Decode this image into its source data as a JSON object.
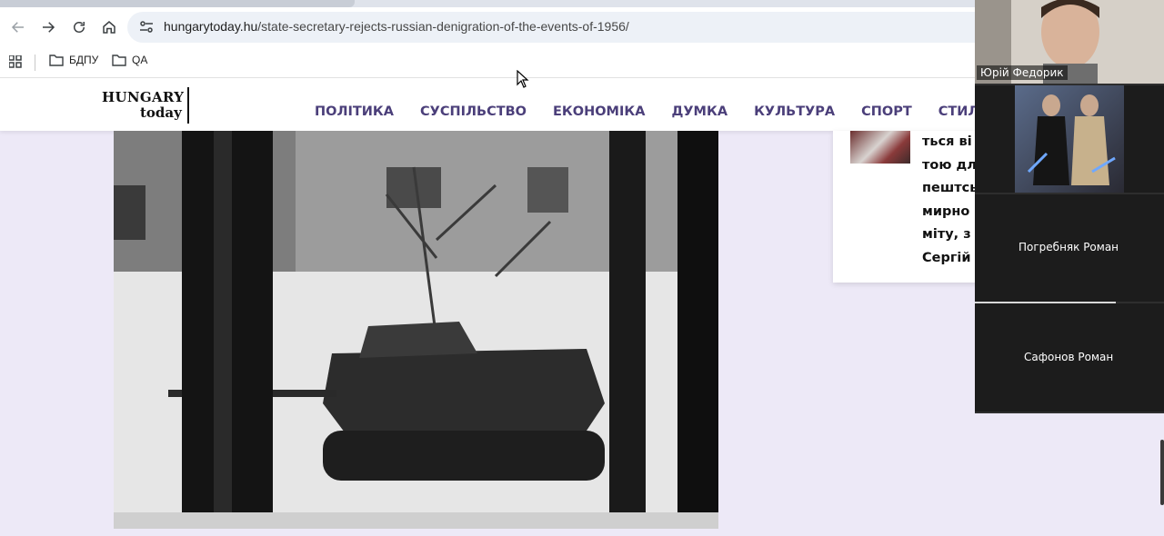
{
  "browser": {
    "url_host": "hungarytoday.hu",
    "url_path": "/state-secretary-rejects-russian-denigration-of-the-events-of-1956/",
    "icons": [
      "back-arrow-icon",
      "forward-arrow-icon",
      "reload-icon",
      "home-icon",
      "site-info-icon"
    ],
    "bookmarks": [
      {
        "label": "БДПУ",
        "icon": "folder-icon"
      },
      {
        "label": "QA",
        "icon": "folder-icon"
      }
    ]
  },
  "site": {
    "logo_line1": "HUNGARY",
    "logo_line2": "today",
    "menu": [
      "ПОЛІТИКА",
      "СУСПІЛЬСТВО",
      "ЕКОНОМІКА",
      "ДУМКА",
      "КУЛЬТУРА",
      "СПОРТ",
      "СТИЛЬ ЖИТТ"
    ],
    "card_lines": [
      "ться ві",
      "тою дл",
      "пештсь",
      "мирно",
      "міту, з",
      "Сергій"
    ]
  },
  "call": {
    "participants": [
      "Юрій Федорик",
      "Погребняк Роман",
      "Сафонов Роман"
    ]
  },
  "colors": {
    "page_background": "#ede9f7",
    "menu_text": "#4b3f7a",
    "call_panel": "#1f1f1f"
  }
}
